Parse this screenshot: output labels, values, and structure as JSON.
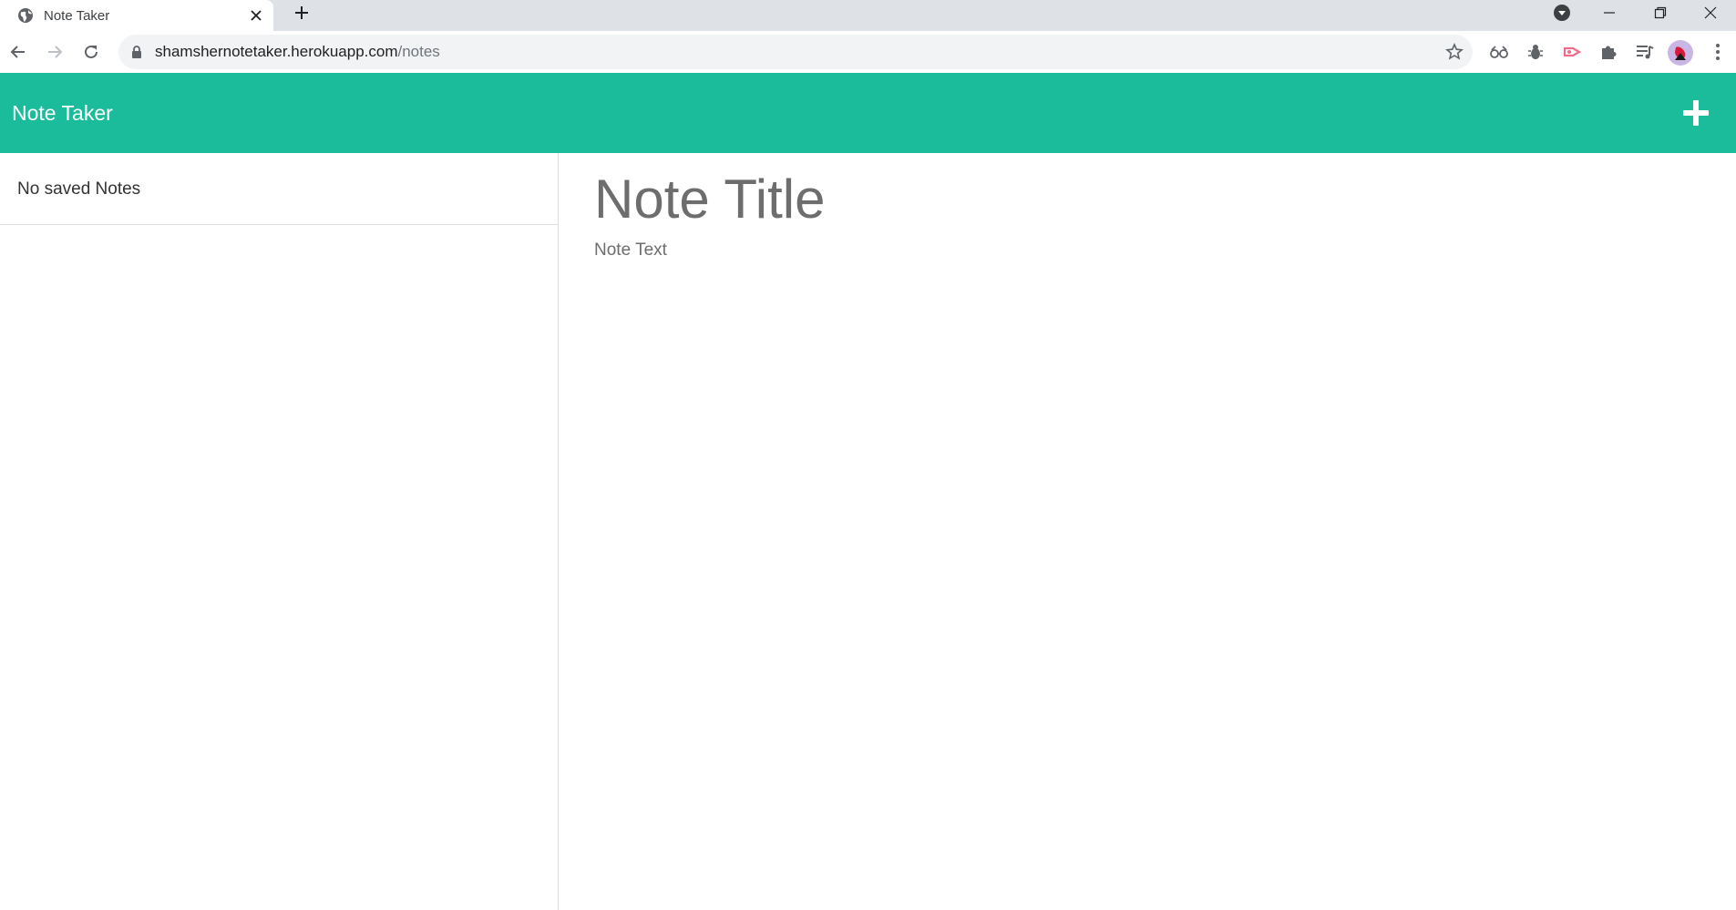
{
  "browser": {
    "tab_title": "Note Taker",
    "url_host": "shamshernotetaker.herokuapp.com",
    "url_path": "/notes"
  },
  "app": {
    "brand": "Note Taker",
    "accent_color": "#1abc9c",
    "new_note_icon": "plus-icon"
  },
  "sidebar": {
    "empty_message": "No saved Notes"
  },
  "editor": {
    "title_placeholder": "Note Title",
    "text_placeholder": "Note Text",
    "title_value": "",
    "text_value": ""
  }
}
